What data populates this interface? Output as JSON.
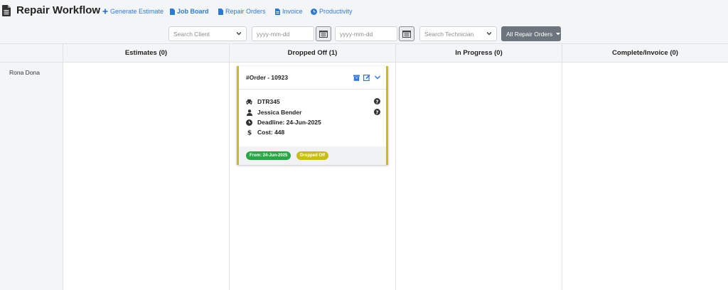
{
  "header": {
    "title": "Repair Workflow",
    "nav": [
      {
        "label": "Generate Estimate",
        "icon": "plus-icon"
      },
      {
        "label": "Job Board",
        "icon": "file-icon"
      },
      {
        "label": "Repair Orders",
        "icon": "file-icon"
      },
      {
        "label": "Invoice",
        "icon": "invoice-icon"
      },
      {
        "label": "Productivity",
        "icon": "clock-icon"
      }
    ]
  },
  "filters": {
    "client_placeholder": "Search Client",
    "date_from_placeholder": "yyyy-mm-dd",
    "date_to_placeholder": "yyyy-mm-dd",
    "technician_placeholder": "Search Technician",
    "orders_button": "All Repair Orders"
  },
  "board": {
    "columns": [
      {
        "label": "Estimates (0)"
      },
      {
        "label": "Dropped Off (1)"
      },
      {
        "label": "In Progress (0)"
      },
      {
        "label": "Complete/Invoice (0)"
      }
    ],
    "technicians": [
      "Rona Dona"
    ]
  },
  "card": {
    "order": "#Order - 10923",
    "plate": "DTR345",
    "customer": "Jessica Bender",
    "deadline": "Deadline: 24-Jun-2025",
    "cost": "Cost: 448",
    "from_badge": "From: 24-Jun-2025",
    "status_badge": "Dropped Off",
    "accent_color": "#c9be0e",
    "from_badge_color": "#28a745",
    "status_badge_color": "#c9be0e"
  }
}
